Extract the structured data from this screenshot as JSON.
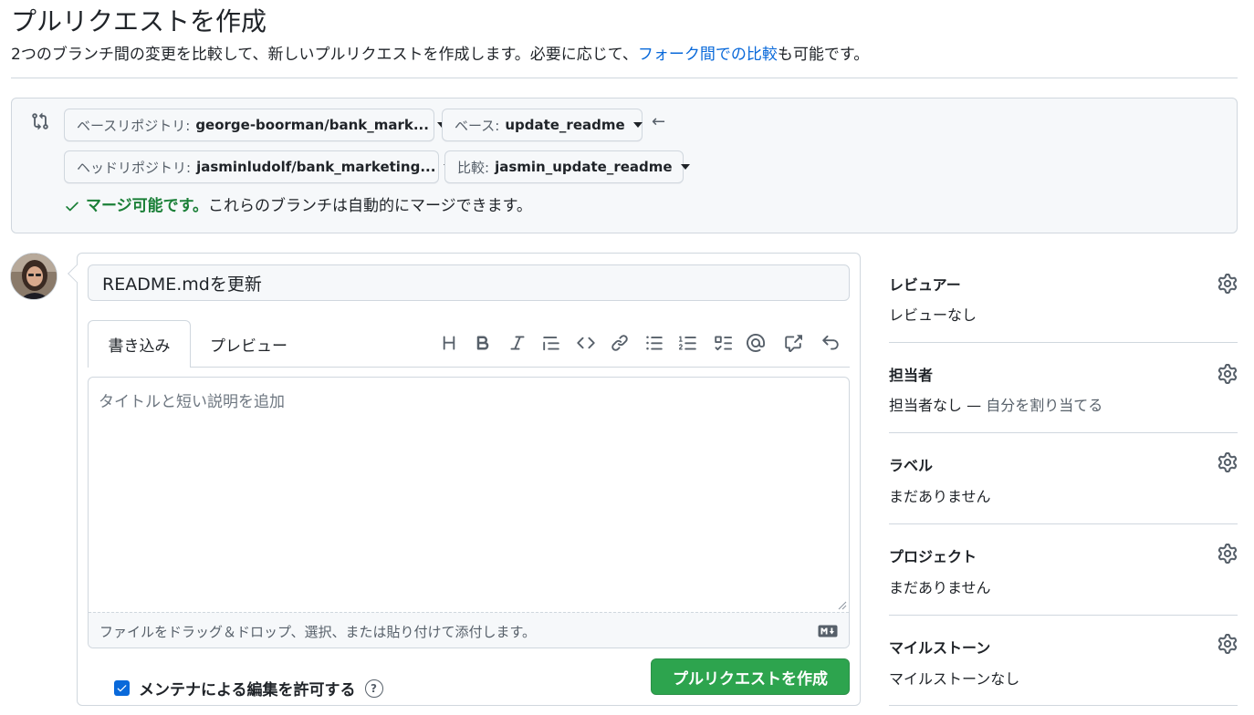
{
  "header": {
    "title": "プルリクエストを作成",
    "subtitle_before": "2つのブランチ間の変更を比較して、新しいプルリクエストを作成します。必要に応じて、",
    "subtitle_link": "フォーク間での比較",
    "subtitle_after": "も可能です。"
  },
  "compare": {
    "base_repo_key": "ベースリポジトリ:",
    "base_repo_value": "george-boorman/bank_mark...",
    "base_key": "ベース:",
    "base_value": "update_readme",
    "head_repo_key": "ヘッドリポジトリ:",
    "head_repo_value": "jasminludolf/bank_marketing...",
    "compare_key": "比較:",
    "compare_value": "jasmin_update_readme",
    "arrow": "←",
    "merge_ok": "マージ可能です。",
    "merge_rest": "これらのブランチは自動的にマージできます。"
  },
  "compose": {
    "title_value": "README.mdを更新",
    "tab_write": "書き込み",
    "tab_preview": "プレビュー",
    "body_placeholder": "タイトルと短い説明を追加",
    "attach_text": "ファイルをドラッグ＆ドロップ、選択、または貼り付けて添付します。",
    "allow_edits": "メンテナによる編集を許可する",
    "help": "?",
    "create_button": "プルリクエストを作成",
    "toolbar_icons": [
      "heading-icon",
      "bold-icon",
      "italic-icon",
      "quote-icon",
      "code-icon",
      "link-icon",
      "bulleted-list-icon",
      "numbered-list-icon",
      "task-list-icon",
      "mention-icon",
      "cross-reference-icon",
      "undo-icon"
    ]
  },
  "sidebar": {
    "reviewers_label": "レビュアー",
    "reviewers_value": "レビューなし",
    "assignees_label": "担当者",
    "assignees_value": "担当者なし",
    "assignees_sep": " — ",
    "assignees_link": "自分を割り当てる",
    "labels_label": "ラベル",
    "labels_value": "まだありません",
    "projects_label": "プロジェクト",
    "projects_value": "まだありません",
    "milestone_label": "マイルストーン",
    "milestone_value": "マイルストーンなし"
  },
  "colors": {
    "accent": "#0969da",
    "success": "#1a7f37",
    "button_green": "#2da44e",
    "border": "#d0d7de",
    "muted": "#57606a"
  }
}
